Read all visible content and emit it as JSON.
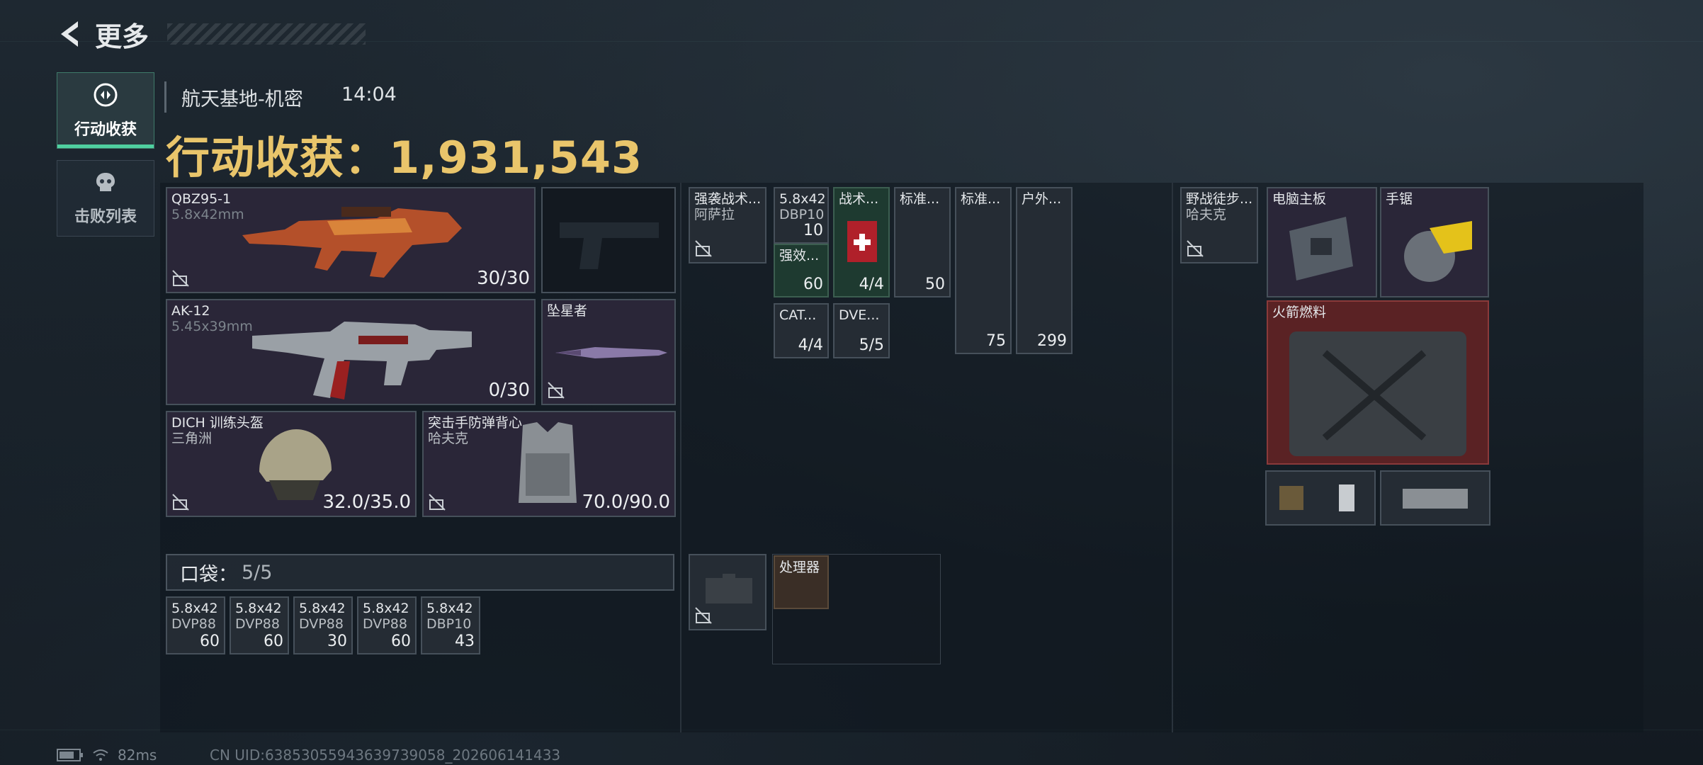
{
  "header": {
    "back_label": "更多"
  },
  "tabs": [
    {
      "label": "行动收获",
      "active": true,
      "icon": "loot-icon"
    },
    {
      "label": "击败列表",
      "active": false,
      "icon": "skull-icon"
    }
  ],
  "raid": {
    "map_name": "航天基地-机密",
    "time": "14:04",
    "haul_label": "行动收获：",
    "haul_value": "1,931,543"
  },
  "loadout": {
    "primary1": {
      "name": "QBZ95-1",
      "ammo_type": "5.8x42mm",
      "ammo": "30/30"
    },
    "pistol": {
      "name": "",
      "empty": true
    },
    "primary2": {
      "name": "AK-12",
      "ammo_type": "5.45x39mm",
      "ammo": "0/30"
    },
    "melee": {
      "name": "坠星者"
    },
    "helmet": {
      "name": "DICH 训练头盔",
      "source": "三角洲",
      "durability": "32.0/35.0"
    },
    "armor": {
      "name": "突击手防弹背心",
      "source": "哈夫克",
      "durability": "70.0/90.0"
    }
  },
  "pocket": {
    "label": "口袋：",
    "count": "5/5",
    "items": [
      {
        "l1": "5.8x42",
        "l2": "DVP88",
        "qty": "60"
      },
      {
        "l1": "5.8x42",
        "l2": "DVP88",
        "qty": "60"
      },
      {
        "l1": "5.8x42",
        "l2": "DVP88",
        "qty": "30"
      },
      {
        "l1": "5.8x42",
        "l2": "DVP88",
        "qty": "60"
      },
      {
        "l1": "5.8x42",
        "l2": "DBP10",
        "qty": "43"
      }
    ]
  },
  "chest_rig": {
    "name": "强袭战术...",
    "source": "阿萨拉"
  },
  "rig_items": [
    {
      "l1": "5.8x42",
      "l2": "DBP10",
      "qty": "10"
    },
    {
      "l1": "强效...",
      "qty": "60"
    },
    {
      "l1": "战术...",
      "qty": "4/4"
    },
    {
      "l1": "标准...",
      "qty": "50"
    },
    {
      "l1": "标准...",
      "qty": "75"
    },
    {
      "l1": "户外...",
      "qty": "299"
    },
    {
      "l1": "CAT...",
      "qty": "4/4"
    },
    {
      "l1": "DVE...",
      "qty": "5/5"
    }
  ],
  "case": {
    "name": "",
    "items": [
      {
        "name": "处理器"
      }
    ]
  },
  "backpack": {
    "name": "野战徒步...",
    "source": "哈夫克"
  },
  "backpack_items": [
    {
      "name": "电脑主板"
    },
    {
      "name": "手锯"
    },
    {
      "name": "火箭燃料"
    }
  ],
  "status": {
    "ping": "82ms",
    "uid": "CN UID:638530559436397390​58_202606141433"
  },
  "colors": {
    "accent_gold": "#e9c56b",
    "active_tab": "#4fd0a0",
    "rare_red": "#5a2224",
    "green_slot": "#1e3a30"
  }
}
